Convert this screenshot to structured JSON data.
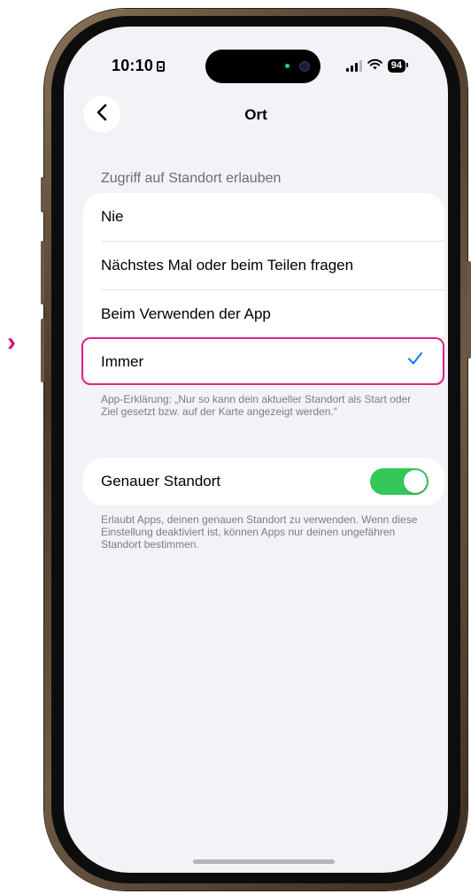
{
  "status_bar": {
    "time": "10:10",
    "battery": "94"
  },
  "nav": {
    "title": "Ort"
  },
  "location_access": {
    "header": "Zugriff auf Standort erlauben",
    "options": [
      {
        "label": "Nie",
        "selected": false
      },
      {
        "label": "Nächstes Mal oder beim Teilen fragen",
        "selected": false
      },
      {
        "label": "Beim Verwenden der App",
        "selected": false
      },
      {
        "label": "Immer",
        "selected": true
      }
    ],
    "footnote": "App-Erklärung: „Nur so kann dein aktueller Standort als Start oder Ziel gesetzt bzw. auf der Karte angezeigt werden.“"
  },
  "precise_location": {
    "label": "Genauer Standort",
    "enabled": true,
    "footnote": "Erlaubt Apps, deinen genauen Standort zu verwenden. Wenn diese Einstellung deaktiviert ist, können Apps nur deinen ungefähren Standort bestimmen."
  },
  "colors": {
    "accent": "#007aff",
    "toggle_on": "#34c759",
    "highlight": "#e0218a",
    "background": "#f2f2f7"
  },
  "icons": {
    "back": "chevron-left-icon",
    "check": "checkmark-icon",
    "marker": "chevron-right-icon"
  }
}
